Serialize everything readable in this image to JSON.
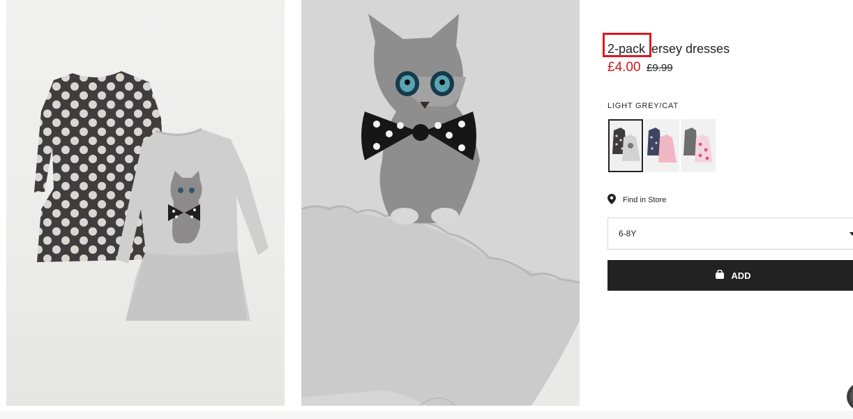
{
  "product": {
    "title": "2-pack jersey dresses",
    "price_current": "£4.00",
    "price_original": "£9.99",
    "color_name": "LIGHT GREY/CAT"
  },
  "swatches": [
    {
      "alt": "Light grey/Cat",
      "selected": true
    },
    {
      "alt": "Dark blue/Pink",
      "selected": false
    },
    {
      "alt": "Grey/Pink",
      "selected": false
    }
  ],
  "find_store": {
    "icon": "location-pin-icon",
    "label": "Find in Store"
  },
  "size_select": {
    "selected": "6-8Y",
    "icon": "chevron-down-icon"
  },
  "add_button": {
    "label": "ADD",
    "icon": "shopping-bag-icon"
  },
  "colors": {
    "sale_price": "#d3161f",
    "button_bg": "#222222",
    "highlight": "#e0161f"
  }
}
